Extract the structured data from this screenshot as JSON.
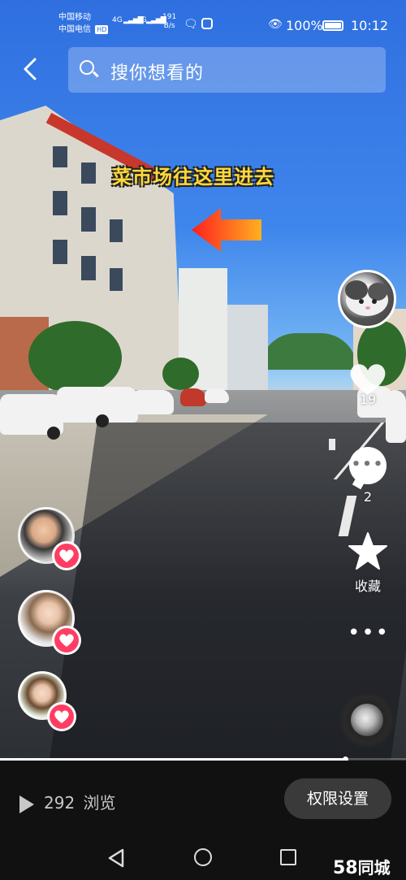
{
  "status_bar": {
    "carrier_1": "中国移动",
    "carrier_2": "中国电信",
    "hd_badge": "HD",
    "network_1": "4G",
    "network_2": "4G",
    "speed_value": "191",
    "speed_unit": "B/s",
    "battery_percent": "100%",
    "battery_level": 1.0,
    "time": "10:12",
    "icons": [
      "wechat-icon",
      "app-tile-icon",
      "eye-icon",
      "battery-icon"
    ]
  },
  "search": {
    "placeholder": "搜你想看的"
  },
  "video": {
    "caption": "菜市场往这里进去"
  },
  "actions": {
    "likes": "19",
    "comments": "2",
    "favorite_label": "收藏"
  },
  "footer": {
    "views_count": "292",
    "views_label": "浏览",
    "permission_button": "权限设置"
  },
  "watermark": {
    "number": "58",
    "text": "同城"
  },
  "progress": 0.85,
  "colors": {
    "like_badge": "#ff3d63",
    "caption_text": "#ffd83a",
    "bottom_bar": "#111111",
    "button_bg": "#3a3a3a"
  }
}
